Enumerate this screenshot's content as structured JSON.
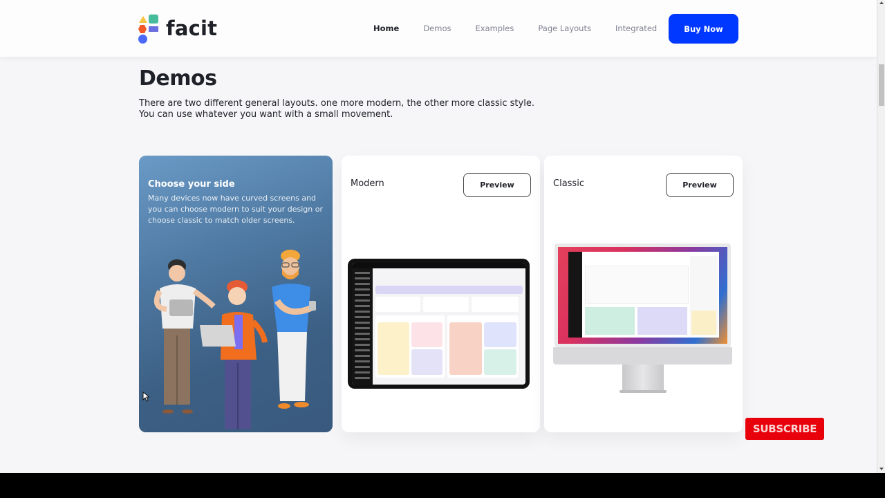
{
  "header": {
    "logo_text": "facit",
    "nav": [
      {
        "label": "Home",
        "active": true
      },
      {
        "label": "Demos",
        "active": false
      },
      {
        "label": "Examples",
        "active": false
      },
      {
        "label": "Page Layouts",
        "active": false
      },
      {
        "label": "Integrated",
        "active": false
      }
    ],
    "buy_label": "Buy Now"
  },
  "section": {
    "title": "Demos",
    "description_line1": "There are two different general layouts. one more modern, the other more classic style.",
    "description_line2": "You can use whatever you want with a small movement."
  },
  "cards": {
    "hero": {
      "title": "Choose your side",
      "text": "Many devices now have curved screens and you can choose modern to suit your design or choose classic to match older screens."
    },
    "modern": {
      "label": "Modern",
      "button": "Preview"
    },
    "classic": {
      "label": "Classic",
      "button": "Preview"
    }
  },
  "overlay": {
    "subscribe_label": "SUBSCRIBE"
  },
  "colors": {
    "brand_blue": "#0038ff",
    "subscribe_red": "#e8000a",
    "text_dark": "#1f2128",
    "text_muted": "#808191"
  }
}
